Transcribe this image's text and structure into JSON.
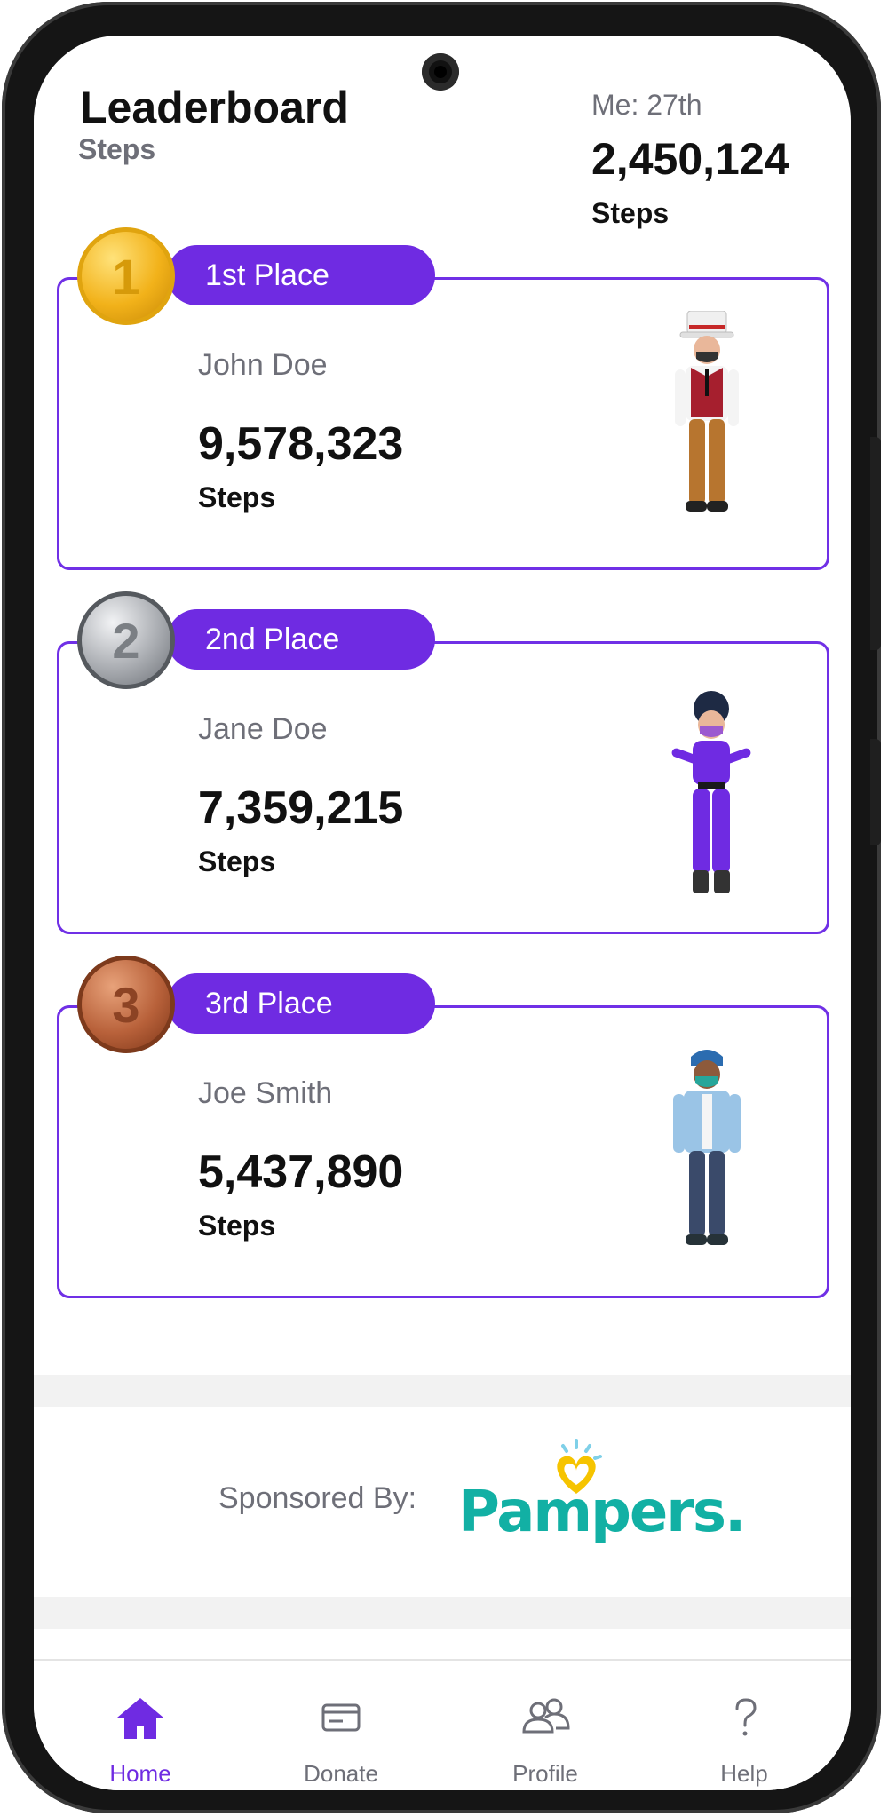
{
  "header": {
    "title": "Leaderboard",
    "subtitle": "Steps",
    "me_rank": "Me: 27th",
    "me_steps": "2,450,124",
    "me_unit": "Steps"
  },
  "leaders": [
    {
      "place": "1st Place",
      "medal": "1",
      "name": "John Doe",
      "steps": "9,578,323",
      "unit": "Steps",
      "medal_color": "#f2b21a"
    },
    {
      "place": "2nd Place",
      "medal": "2",
      "name": "Jane Doe",
      "steps": "7,359,215",
      "unit": "Steps",
      "medal_color": "#a9acb1"
    },
    {
      "place": "3rd Place",
      "medal": "3",
      "name": "Joe Smith",
      "steps": "5,437,890",
      "unit": "Steps",
      "medal_color": "#b8613a"
    }
  ],
  "sponsor": {
    "label": "Sponsored By:",
    "brand": "Pampers."
  },
  "tabs": [
    {
      "label": "Home",
      "icon": "home-icon",
      "active": true
    },
    {
      "label": "Donate",
      "icon": "card-icon",
      "active": false
    },
    {
      "label": "Profile",
      "icon": "users-icon",
      "active": false
    },
    {
      "label": "Help",
      "icon": "question-icon",
      "active": false
    }
  ],
  "colors": {
    "accent": "#6f2be2",
    "card_border": "#7030e6",
    "text_muted": "#6e6f78",
    "brand_teal": "#12b0a4"
  }
}
